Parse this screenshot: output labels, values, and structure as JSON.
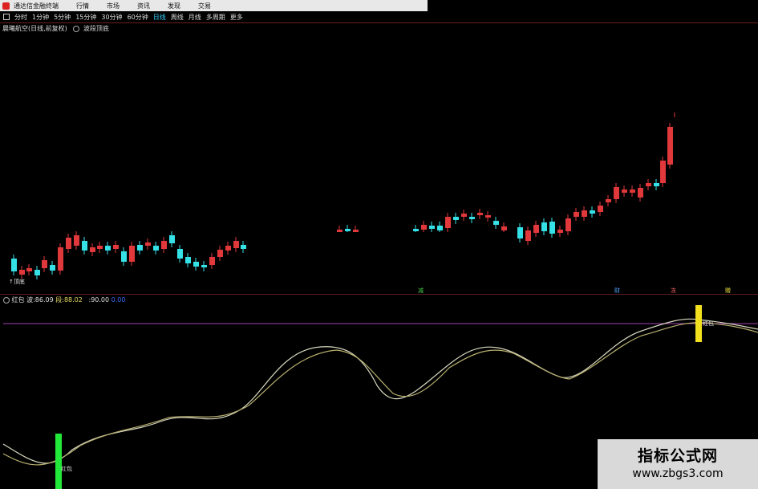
{
  "menu": {
    "app_title": "通达信金融终端",
    "items": [
      "行情",
      "市场",
      "资讯",
      "发现",
      "交易"
    ]
  },
  "periods": {
    "items": [
      "分时",
      "1分钟",
      "5分钟",
      "15分钟",
      "30分钟",
      "60分钟",
      "日线",
      "周线",
      "月线",
      "多周期",
      "更多"
    ],
    "active_index": 6
  },
  "chart": {
    "title": "晨曦航空(日线,前复权)",
    "indicator": "波段顶底"
  },
  "indicator": {
    "name": "红包",
    "wave_label": "波:",
    "wave_value": "86.09",
    "seg_label": "段:",
    "seg_value": "88.02",
    "level_label": ":",
    "level_value": "90.00",
    "extra_value": "0.00"
  },
  "annotations": {
    "bottom_label_left": "↑顶底",
    "event_1": "减",
    "event_2": "财",
    "event_3": "冻",
    "event_4": "赠",
    "signal_1": "红包",
    "signal_2": "红包"
  },
  "watermark": {
    "title": "指标公式网",
    "url": "www.zbgs3.com"
  },
  "colors": {
    "up": "#e0383b",
    "down": "#35e0e6",
    "line_a": "#d8d8c0",
    "line_b": "#b8b070",
    "signal_green": "#22e83a",
    "signal_yellow": "#f2e01e",
    "level_line": "#a040b0"
  },
  "chart_data": {
    "type": "candlestick",
    "candles": [
      {
        "o": 0,
        "h": 0,
        "l": 0,
        "c": 0
      }
    ]
  }
}
